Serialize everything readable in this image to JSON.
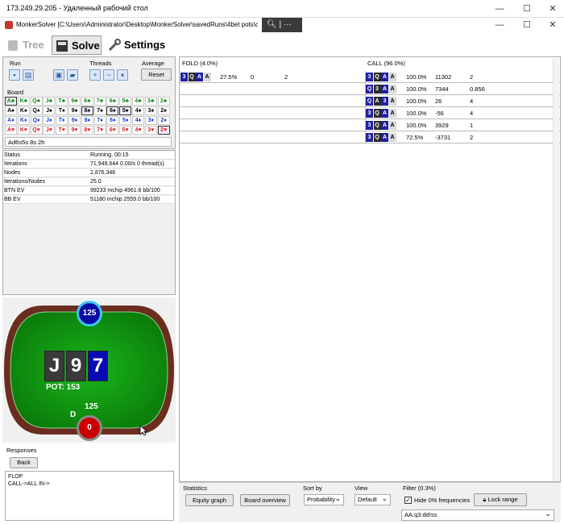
{
  "rdp": {
    "title": "173.249.29.205 - Удаленный рабочий стол"
  },
  "app": {
    "title": "MonkerSolver [C:\\Users\\Administrator\\Desktop\\MonkerSolver\\savedRuns\\4bet pots\\cob"
  },
  "tabs": [
    {
      "label": "Tree"
    },
    {
      "label": "Solve"
    },
    {
      "label": "Settings"
    }
  ],
  "run": {
    "label": "Run",
    "threads_label": "Threads",
    "average_label": "Average",
    "reset_label": "Reset"
  },
  "board": {
    "label": "Board",
    "ranks": [
      "A",
      "K",
      "Q",
      "J",
      "T",
      "9",
      "8",
      "7",
      "6",
      "5",
      "4",
      "3",
      "2"
    ],
    "suits": [
      "♣",
      "♠",
      "♦",
      "♥"
    ],
    "suit_colors": [
      "#1a8a1a",
      "#000000",
      "#1a3ed8",
      "#e02020"
    ],
    "selected": [
      "A♣",
      "6♠",
      "5♠",
      "8♠",
      "2♥"
    ],
    "value": "Ad6s5s 8s 2h"
  },
  "stats": [
    {
      "k": "Status",
      "v": "Running, 00:15"
    },
    {
      "k": "Iterations",
      "v": "71,949,644  0.00/s 0 thread(s)"
    },
    {
      "k": "Nodes",
      "v": "2,876,346"
    },
    {
      "k": "Iterations/Nodes",
      "v": "25.0"
    },
    {
      "k": "BTN EV",
      "v": "99233 mchip   4961.6 bb/100"
    },
    {
      "k": "BB EV",
      "v": "51180 mchip   2559.0 bb/100"
    }
  ],
  "table": {
    "top_stack": "125",
    "board_cards": [
      "J",
      "9",
      "7"
    ],
    "pot": "POT: 153",
    "bottom_stack": "125",
    "bottom_bet": "0",
    "dealer": "D"
  },
  "responses": {
    "label": "Responses",
    "back": "Back",
    "log": [
      "FLOP",
      "CALL->ALL IN->"
    ]
  },
  "grid": {
    "fold_header": "FOLD (4.0%)",
    "call_header": "CALL (96.0%)",
    "fold_rows": [
      {
        "hand": [
          "3",
          "Q",
          "A",
          "A"
        ],
        "freq": "27.5%",
        "ev": "0",
        "count": "2"
      }
    ],
    "call_rows": [
      {
        "hand": [
          "3",
          "Q",
          "A",
          "A"
        ],
        "freq": "100.0%",
        "ev": "11302",
        "count": "2"
      },
      {
        "hand": [
          "Q",
          "3",
          "A",
          "A"
        ],
        "freq": "100.0%",
        "ev": "7344",
        "count": "0.856"
      },
      {
        "hand": [
          "Q",
          "A",
          "3",
          "A"
        ],
        "freq": "100.0%",
        "ev": "26",
        "count": "4"
      },
      {
        "hand": [
          "3",
          "Q",
          "A",
          "A"
        ],
        "freq": "100.0%",
        "ev": "-56",
        "count": "4"
      },
      {
        "hand": [
          "3",
          "Q",
          "A",
          "A"
        ],
        "freq": "100.0%",
        "ev": "3929",
        "count": "1"
      },
      {
        "hand": [
          "3",
          "Q",
          "A",
          "A"
        ],
        "freq": "72.5%",
        "ev": "-3731",
        "count": "2"
      }
    ]
  },
  "bottom": {
    "statistics_label": "Statistics",
    "equity_graph": "Equity graph",
    "board_overview": "Board overview",
    "sort_label": "Sort by",
    "sort_value": "Probability",
    "view_label": "View",
    "view_value": "Default",
    "filter_label": "Filter (0.3%)",
    "hide_label": "Hide 0% frequencies",
    "lock_label": "Lock range",
    "filter_value": "AA:q3:dd!ss"
  }
}
